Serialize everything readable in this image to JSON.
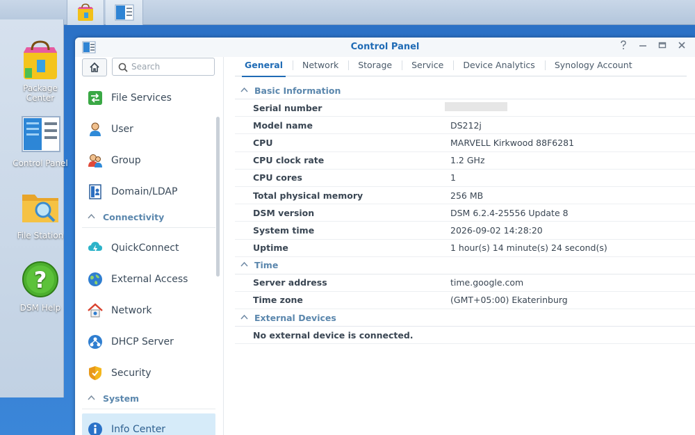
{
  "desktop": {
    "icons": [
      {
        "label_line1": "Package",
        "label_line2": "Center"
      },
      {
        "label_line1": "Control Panel",
        "label_line2": ""
      },
      {
        "label_line1": "File Station",
        "label_line2": ""
      },
      {
        "label_line1": "DSM Help",
        "label_line2": ""
      }
    ]
  },
  "window": {
    "title": "Control Panel"
  },
  "sidebar": {
    "search_placeholder": "Search",
    "items": [
      {
        "label": "File Services"
      },
      {
        "label": "User"
      },
      {
        "label": "Group"
      },
      {
        "label": "Domain/LDAP"
      }
    ],
    "cat_connectivity": "Connectivity",
    "connectivity_items": [
      {
        "label": "QuickConnect"
      },
      {
        "label": "External Access"
      },
      {
        "label": "Network"
      },
      {
        "label": "DHCP Server"
      },
      {
        "label": "Security"
      }
    ],
    "cat_system": "System",
    "system_items": [
      {
        "label": "Info Center"
      }
    ]
  },
  "tabs": [
    "General",
    "Network",
    "Storage",
    "Service",
    "Device Analytics",
    "Synology Account"
  ],
  "sections": {
    "basic": {
      "title": "Basic Information",
      "rows": [
        {
          "k": "Serial number",
          "v": ""
        },
        {
          "k": "Model name",
          "v": "DS212j"
        },
        {
          "k": "CPU",
          "v": "MARVELL Kirkwood 88F6281"
        },
        {
          "k": "CPU clock rate",
          "v": "1.2 GHz"
        },
        {
          "k": "CPU cores",
          "v": "1"
        },
        {
          "k": "Total physical memory",
          "v": "256 MB"
        },
        {
          "k": "DSM version",
          "v": "DSM 6.2.4-25556 Update 8"
        },
        {
          "k": "System time",
          "v": "2026-09-02 14:28:20"
        },
        {
          "k": "Uptime",
          "v": "1 hour(s) 14 minute(s) 24 second(s)"
        }
      ]
    },
    "time": {
      "title": "Time",
      "rows": [
        {
          "k": "Server address",
          "v": "time.google.com"
        },
        {
          "k": "Time zone",
          "v": "(GMT+05:00) Ekaterinburg"
        }
      ]
    },
    "external": {
      "title": "External Devices",
      "message": "No external device is connected."
    }
  }
}
